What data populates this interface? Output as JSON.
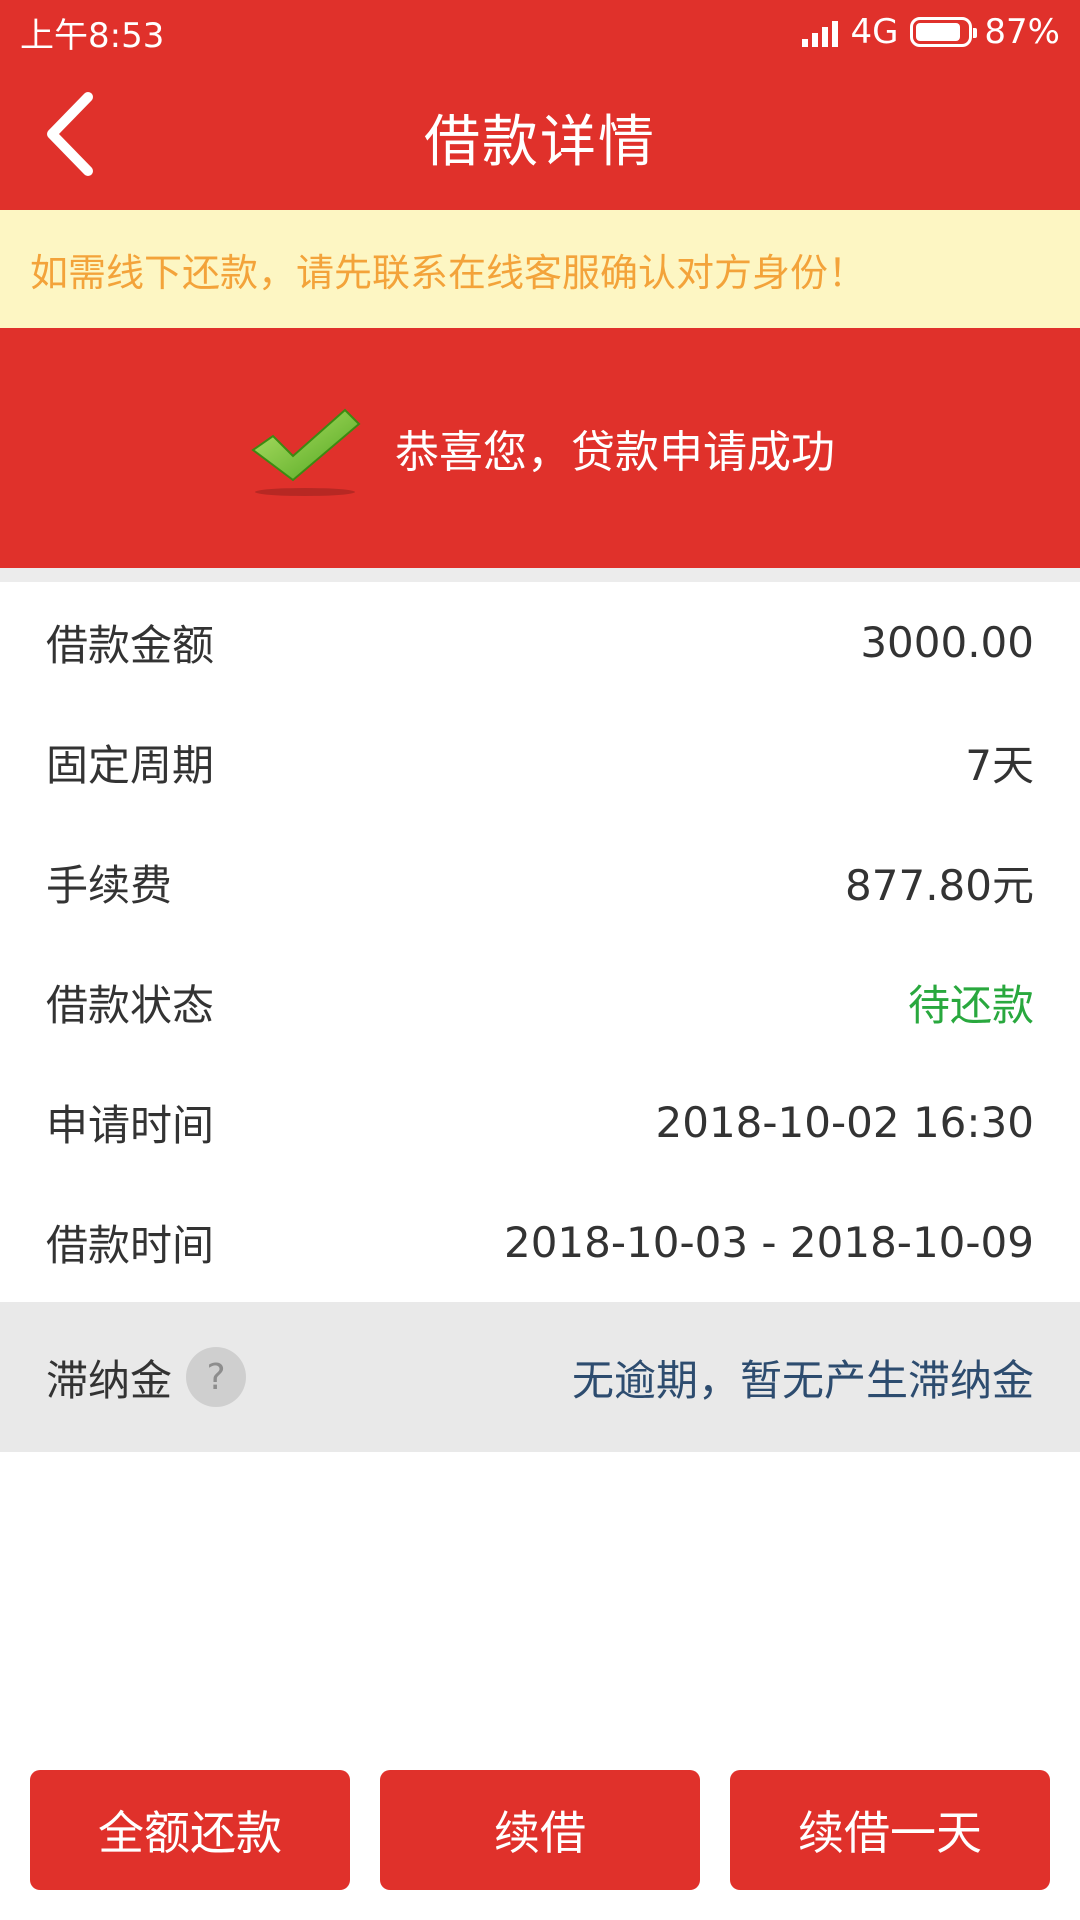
{
  "status_bar": {
    "time": "上午8:53",
    "network": "4G",
    "battery": "87%",
    "battery_level": 0.87
  },
  "header": {
    "title": "借款详情",
    "back_icon": "chevron-left-icon"
  },
  "notice": {
    "text": "如需线下还款，请先联系在线客服确认对方身份！"
  },
  "banner": {
    "text": "恭喜您，贷款申请成功",
    "icon": "check-icon"
  },
  "details": [
    {
      "label": "借款金额",
      "value": "3000.00"
    },
    {
      "label": "固定周期",
      "value": "7天"
    },
    {
      "label": "手续费",
      "value": "877.80元"
    },
    {
      "label": "借款状态",
      "value": "待还款",
      "value_color": "#29a83e"
    },
    {
      "label": "申请时间",
      "value": "2018-10-02 16:30"
    },
    {
      "label": "借款时间",
      "value": "2018-10-03 - 2018-10-09"
    }
  ],
  "late_fee": {
    "label": "滞纳金",
    "help_icon": "question-icon",
    "help_symbol": "?",
    "value": "无逾期，暂无产生滞纳金"
  },
  "actions": {
    "full_repay": "全额还款",
    "renew": "续借",
    "renew_one_day": "续借一天"
  },
  "colors": {
    "primary": "#e0312b",
    "notice_bg": "#fdf6c3",
    "notice_text": "#f3a33a",
    "status_green": "#29a83e",
    "late_value": "#2d4c6f"
  }
}
